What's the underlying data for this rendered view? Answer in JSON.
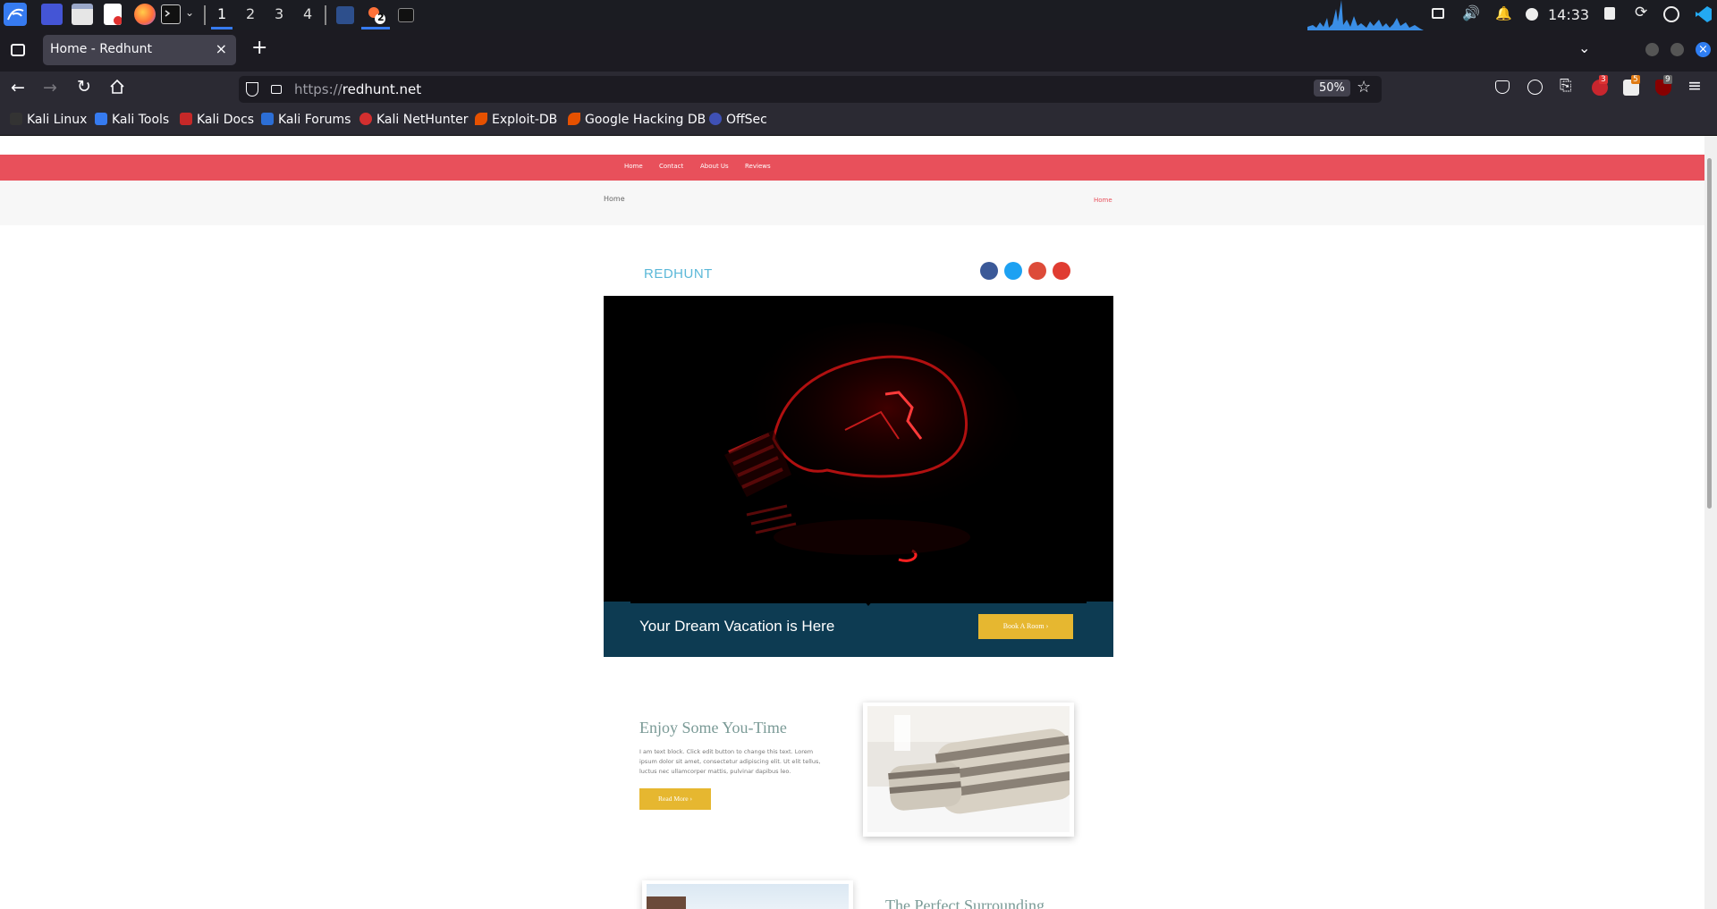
{
  "taskbar": {
    "workspaces": [
      "1",
      "2",
      "3",
      "4"
    ],
    "active_workspace": "1",
    "clock": "14:33",
    "firefox_badge": "2",
    "accent": "#367bf0"
  },
  "browser": {
    "tab_title": "Home - Redhunt",
    "url_prefix": "https://",
    "url_domain": "redhunt.net",
    "zoom": "50%",
    "extension_badges": [
      "3",
      "5",
      "9"
    ],
    "bookmarks": [
      "Kali Linux",
      "Kali Tools",
      "Kali Docs",
      "Kali Forums",
      "Kali NetHunter",
      "Exploit-DB",
      "Google Hacking DB",
      "OffSec"
    ]
  },
  "site": {
    "nav": [
      "Home",
      "Contact",
      "About Us",
      "Reviews"
    ],
    "nav_bg": "#e8505b",
    "breadcrumb_left": "Home",
    "breadcrumb_right": "Home",
    "brand": "REDHUNT",
    "social": [
      {
        "name": "facebook",
        "color": "#3b5998",
        "glyph": "f"
      },
      {
        "name": "twitter",
        "color": "#1da1f2",
        "glyph": "t"
      },
      {
        "name": "google-plus",
        "color": "#dd4b39",
        "glyph": "g"
      },
      {
        "name": "pinterest",
        "color": "#e03c31",
        "glyph": "p"
      }
    ],
    "hero": {
      "caption": "Your Dream Vacation is Here",
      "button": "Book A Room",
      "band_color": "#0d3b52",
      "button_color": "#e6b730"
    },
    "feature1": {
      "title": "Enjoy Some You-Time",
      "body": "I am text block. Click edit button to change this text. Lorem ipsum dolor sit amet, consectetur adipiscing elit. Ut elit tellus, luctus nec ullamcorper mattis, pulvinar dapibus leo.",
      "button": "Read More"
    },
    "feature2": {
      "title": "The Perfect Surrounding"
    }
  }
}
